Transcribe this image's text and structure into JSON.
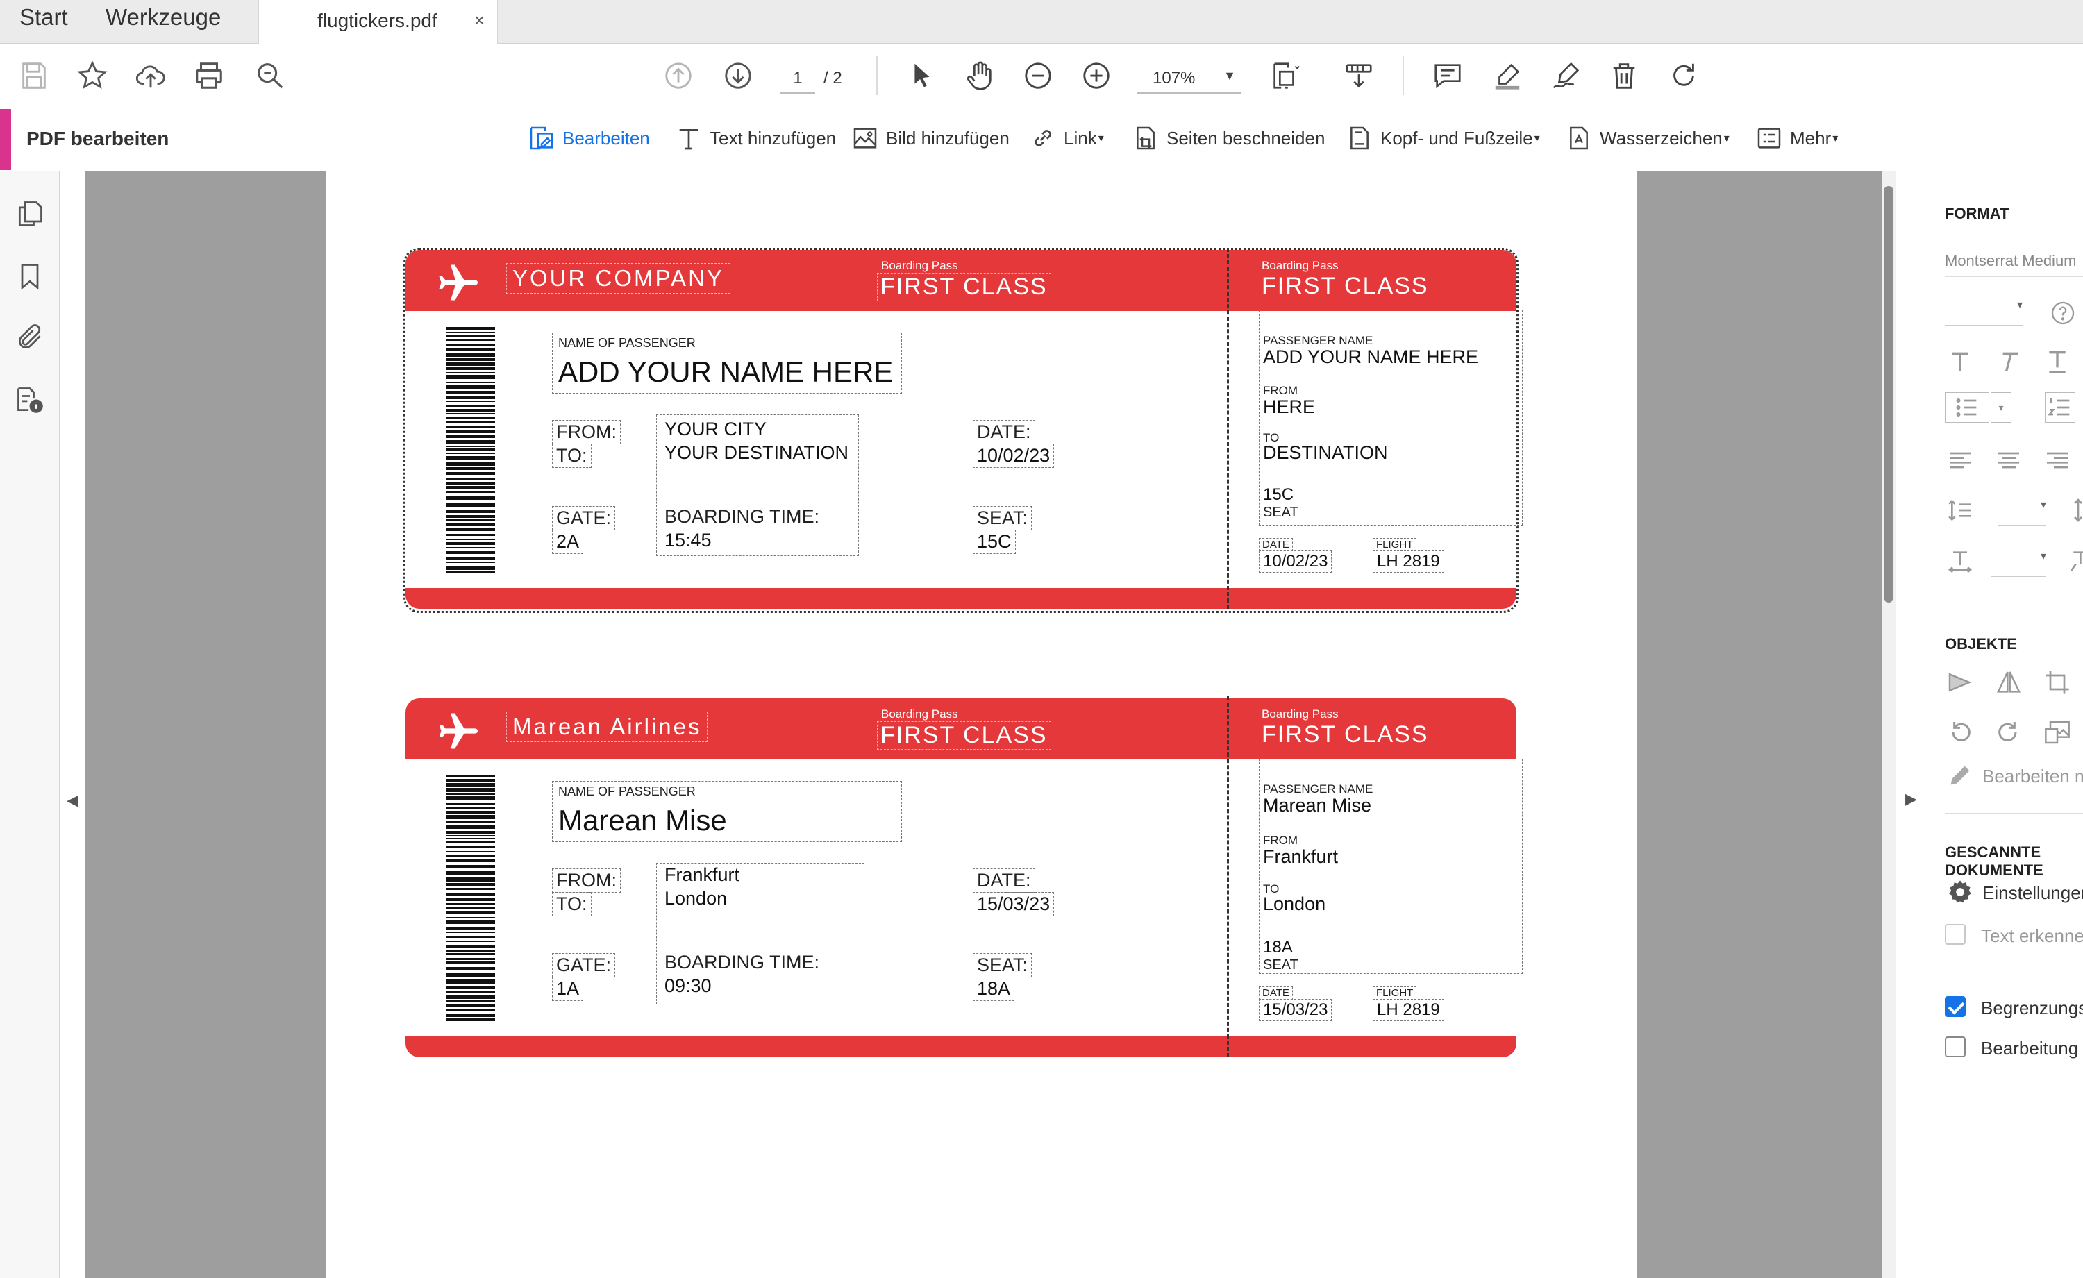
{
  "tabs": {
    "start": "Start",
    "tools": "Werkzeuge",
    "document": "flugtickers.pdf",
    "close": "×"
  },
  "toolbar": {
    "page_current": "1",
    "page_total": "/ 2",
    "zoom": "107%",
    "icons": [
      "save-icon",
      "star-icon",
      "upload-icon",
      "print-icon",
      "search-icon",
      "page-up-icon",
      "page-down-icon",
      "select-icon",
      "hand-icon",
      "zoom-out-icon",
      "zoom-in-icon",
      "fit-page-icon",
      "read-mode-icon",
      "comment-icon",
      "highlight-icon",
      "sign-icon",
      "delete-icon",
      "rotate-icon"
    ]
  },
  "editbar": {
    "title": "PDF bearbeiten",
    "items": {
      "edit": "Bearbeiten",
      "add_text": "Text hinzufügen",
      "add_image": "Bild hinzufügen",
      "link": "Link",
      "crop": "Seiten beschneiden",
      "header_footer": "Kopf- und Fußzeile",
      "watermark": "Wasserzeichen",
      "more": "Mehr"
    },
    "accent_color": "#d9338e",
    "active_color": "#1473e6"
  },
  "tickets": [
    {
      "company": "YOUR COMPANY",
      "bp_small": "Boarding Pass",
      "bp_big": "FIRST CLASS",
      "name_label": "NAME OF PASSENGER",
      "name": "ADD YOUR NAME HERE",
      "from_label": "FROM:",
      "to_label": "TO:",
      "from": "YOUR CITY",
      "to": "YOUR DESTINATION",
      "gate_label": "GATE:",
      "gate": "2A",
      "boarding_label": "BOARDING TIME:",
      "boarding": "15:45",
      "date_label": "DATE:",
      "date": "10/02/23",
      "seat_label": "SEAT:",
      "seat": "15C",
      "stub": {
        "bp_small": "Boarding Pass",
        "bp_big": "FIRST CLASS",
        "passenger_label": "PASSENGER NAME",
        "passenger": "ADD YOUR NAME HERE",
        "from_label": "FROM",
        "from": "HERE",
        "to_label": "TO",
        "to": "DESTINATION",
        "seat": "15C",
        "seat_label": "SEAT",
        "date_label": "DATE",
        "date": "10/02/23",
        "flight_label": "FLIGHT",
        "flight": "LH 2819"
      }
    },
    {
      "company": "Marean Airlines",
      "bp_small": "Boarding Pass",
      "bp_big": "FIRST CLASS",
      "name_label": "NAME OF PASSENGER",
      "name": "Marean Mise",
      "from_label": "FROM:",
      "to_label": "TO:",
      "from": "Frankfurt",
      "to": "London",
      "gate_label": "GATE:",
      "gate": "1A",
      "boarding_label": "BOARDING TIME:",
      "boarding": "09:30",
      "date_label": "DATE:",
      "date": "15/03/23",
      "seat_label": "SEAT:",
      "seat": "18A",
      "stub": {
        "bp_small": "Boarding Pass",
        "bp_big": "FIRST CLASS",
        "passenger_label": "PASSENGER NAME",
        "passenger": "Marean Mise",
        "from_label": "FROM",
        "from": "Frankfurt",
        "to_label": "TO",
        "to": "London",
        "seat": "18A",
        "seat_label": "SEAT",
        "date_label": "DATE",
        "date": "15/03/23",
        "flight_label": "FLIGHT",
        "flight": "LH 2819"
      }
    }
  ],
  "ticket_color": "#e4383b",
  "rightpanel": {
    "format": "FORMAT",
    "font": "Montserrat Medium",
    "objects": "OBJEKTE",
    "edit_obj": "Bearbeiten mit",
    "scanned": "GESCANNTE DOKUMENTE",
    "settings": "Einstellungen",
    "recognize": "Text erkennen",
    "bounding": "Begrenzungsrahmen anzeigen",
    "bounding_checked": true,
    "editing": "Bearbeitung einschränken",
    "editing_checked": false,
    "help": "?"
  }
}
